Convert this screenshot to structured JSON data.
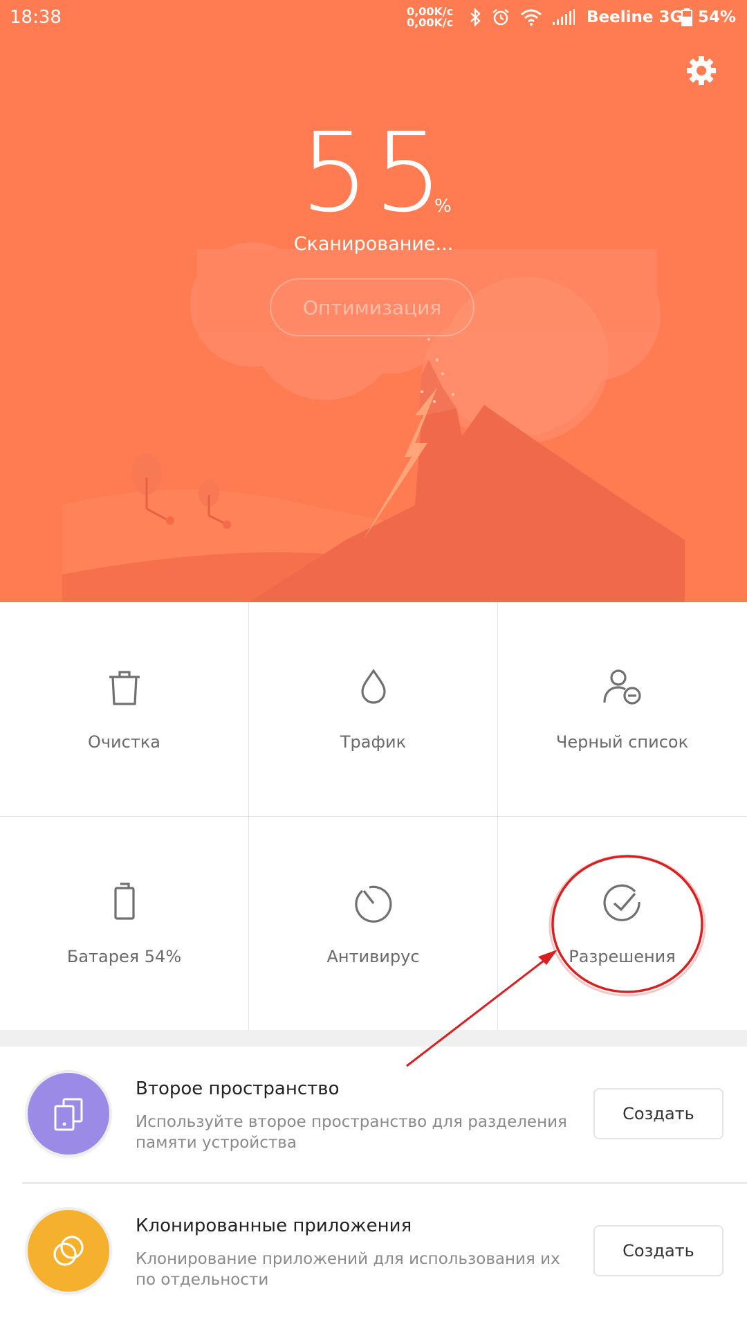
{
  "status_bar": {
    "time": "18:38",
    "speed_up": "0,00K/c",
    "speed_down": "0,00K/c",
    "carrier": "Beeline 3G",
    "battery": "54%",
    "icons": [
      "bluetooth-icon",
      "alarm-icon",
      "wifi-icon",
      "signal-icon",
      "battery-icon"
    ]
  },
  "hero": {
    "score": "55",
    "score_unit": "%",
    "status_text": "Сканирование...",
    "optimize_label": "Оптимизация",
    "background_color": "#ff7b52"
  },
  "grid": {
    "tiles": [
      {
        "label": "Очистка",
        "icon": "trash-icon"
      },
      {
        "label": "Трафик",
        "icon": "drop-icon"
      },
      {
        "label": "Черный список",
        "icon": "user-block-icon"
      },
      {
        "label": "Батарея 54%",
        "icon": "battery-icon"
      },
      {
        "label": "Антивирус",
        "icon": "antivirus-icon"
      },
      {
        "label": "Разрешения",
        "icon": "check-circle-icon"
      }
    ]
  },
  "features": [
    {
      "title": "Второе пространство",
      "description": "Используйте второе пространство для разделения памяти устройства",
      "button": "Создать",
      "icon": "second-space-icon",
      "color": "#9b8ae6"
    },
    {
      "title": "Клонированные приложения",
      "description": "Клонирование приложений для использования их по отдельности",
      "button": "Создать",
      "icon": "clone-apps-icon",
      "color": "#f5b12e"
    }
  ],
  "annotation_color": "#d91f1f"
}
